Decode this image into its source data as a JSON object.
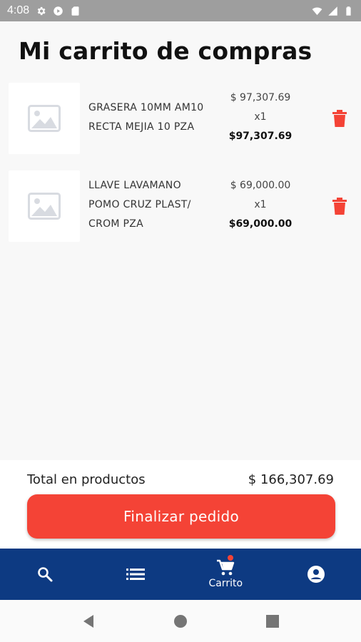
{
  "status_bar": {
    "time": "4:08",
    "icons": [
      "gear-icon",
      "play-icon",
      "sd-card-icon",
      "wifi-icon",
      "signal-icon",
      "battery-icon"
    ]
  },
  "page": {
    "title": "Mi carrito de compras"
  },
  "cart": {
    "items": [
      {
        "name_line1": "GRASERA 10MM AM10",
        "name_line2": "RECTA MEJIA  10 PZA",
        "name_line3": "",
        "unit_price": "$ 97,307.69",
        "quantity": "x1",
        "line_total": "$97,307.69",
        "image_icon": "image-placeholder-icon",
        "delete_icon": "trash-icon"
      },
      {
        "name_line1": "LLAVE LAVAMANO",
        "name_line2": "POMO CRUZ PLAST/",
        "name_line3": "CROM PZA",
        "unit_price": "$ 69,000.00",
        "quantity": "x1",
        "line_total": "$69,000.00",
        "image_icon": "image-placeholder-icon",
        "delete_icon": "trash-icon"
      }
    ]
  },
  "summary": {
    "total_label": "Total en productos",
    "total_value": "$ 166,307.69",
    "checkout_label": "Finalizar pedido"
  },
  "bottom_nav": {
    "items": [
      {
        "icon": "search-icon",
        "label": ""
      },
      {
        "icon": "list-icon",
        "label": ""
      },
      {
        "icon": "cart-icon",
        "label": "Carrito"
      },
      {
        "icon": "account-icon",
        "label": ""
      }
    ]
  },
  "colors": {
    "accent": "#f44336",
    "nav_background": "#0d3a82",
    "status_bar": "#9e9e9e"
  }
}
